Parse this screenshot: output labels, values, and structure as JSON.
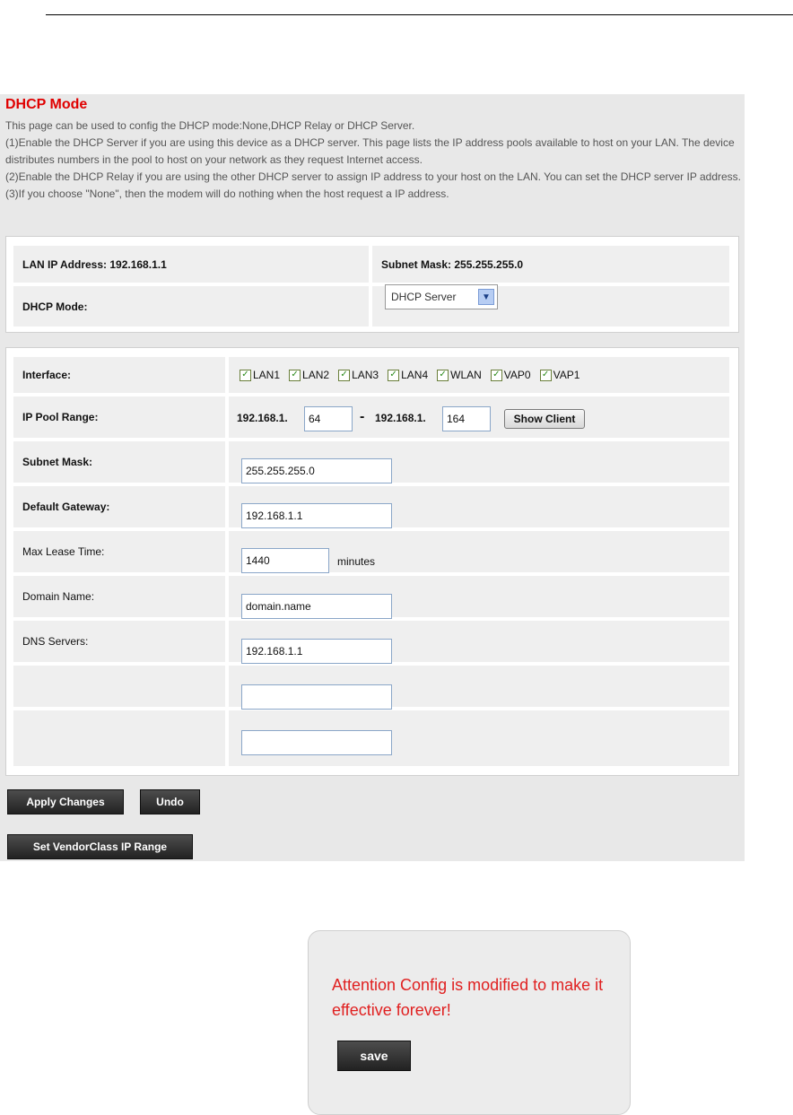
{
  "header": {
    "title": "DHCP Mode",
    "description": [
      "This page can be used to config the DHCP mode:None,DHCP Relay or DHCP Server.",
      "(1)Enable the DHCP Server if you are using this device as a DHCP server. This page lists the IP address pools available to host on your LAN. The device distributes numbers in the pool to host on your network as they request Internet access.",
      "(2)Enable the DHCP Relay if you are using the other DHCP server to assign IP address to your host on the LAN. You can set the DHCP server IP address.",
      "(3)If you choose \"None\", then the modem will do nothing when the host request a IP address."
    ]
  },
  "lan_info": {
    "lan_ip_label": "LAN IP Address: 192.168.1.1",
    "subnet_label": "Subnet Mask: 255.255.255.0",
    "dhcp_mode_label": "DHCP Mode:",
    "dhcp_mode_value": "DHCP Server"
  },
  "config": {
    "interface_label": "Interface:",
    "interfaces": [
      {
        "name": "LAN1",
        "checked": true
      },
      {
        "name": "LAN2",
        "checked": true
      },
      {
        "name": "LAN3",
        "checked": true
      },
      {
        "name": "LAN4",
        "checked": true
      },
      {
        "name": "WLAN",
        "checked": true
      },
      {
        "name": "VAP0",
        "checked": true
      },
      {
        "name": "VAP1",
        "checked": true
      }
    ],
    "ip_pool_label": "IP Pool Range:",
    "ip_prefix_start": "192.168.1.",
    "ip_start": "64",
    "range_sep": "-",
    "ip_prefix_end": "192.168.1.",
    "ip_end": "164",
    "show_client_label": "Show Client",
    "subnet_mask_label": "Subnet Mask:",
    "subnet_mask_value": "255.255.255.0",
    "gateway_label": "Default Gateway:",
    "gateway_value": "192.168.1.1",
    "lease_label": "Max Lease Time:",
    "lease_value": "1440",
    "lease_unit": "minutes",
    "domain_label": "Domain Name:",
    "domain_value": "domain.name",
    "dns_label": "DNS Servers:",
    "dns_values": [
      "192.168.1.1",
      "",
      ""
    ]
  },
  "actions": {
    "apply": "Apply Changes",
    "undo": "Undo",
    "vendor": "Set VendorClass IP Range"
  },
  "attention": {
    "message": "Attention Config is modified to make it effective forever!",
    "save": "save"
  },
  "colors": {
    "title_red": "#e00000",
    "panel_bg": "#e8e8e8",
    "row_bg": "#efefef",
    "dark_button": "#333333",
    "checkbox_tick": "#2a8a1a"
  }
}
